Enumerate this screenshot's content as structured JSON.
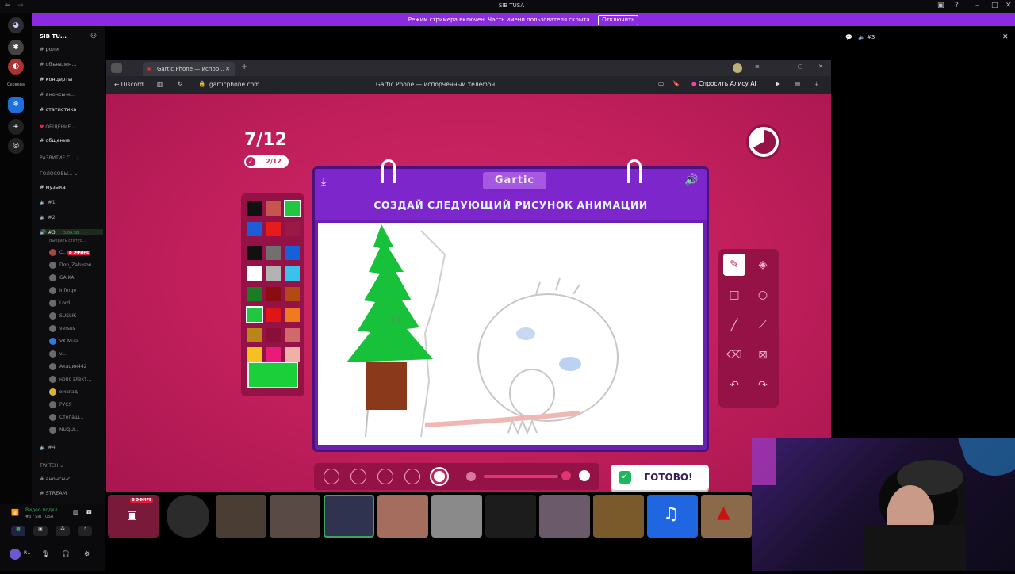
{
  "window_title": "SIB TUSA",
  "stream_mode": {
    "message": "Режим стримера включен. Часть имени пользователя скрыта.",
    "button": "Отключить"
  },
  "servers": {
    "label_under_first": "Сервера"
  },
  "sidebar": {
    "server_name": "SIB TU...",
    "items": [
      {
        "type": "text",
        "label": "роли"
      },
      {
        "type": "text",
        "label": "объявлен..."
      },
      {
        "type": "text",
        "label": "концерты"
      },
      {
        "type": "text",
        "label": "анонсы-к..."
      },
      {
        "type": "text",
        "label": "статистика"
      },
      {
        "type": "category",
        "label": "ОБЩЕНИЕ"
      },
      {
        "type": "text",
        "label": "общение"
      },
      {
        "type": "category",
        "label": "РАЗВИТИЕ С..."
      },
      {
        "type": "category",
        "label": "ГОЛОСОВЫ..."
      },
      {
        "type": "text",
        "label": "музыка"
      },
      {
        "type": "voice",
        "label": "#1"
      },
      {
        "type": "voice",
        "label": "#2"
      },
      {
        "type": "voice",
        "label": "#3"
      }
    ],
    "current_voice_status": "Выбрать статус...",
    "current_voice_time": "3:06:38",
    "voice_users": [
      {
        "name": "С..",
        "live": "В ЭФИРЕ"
      },
      {
        "name": "Don_Zakuson"
      },
      {
        "name": "GAIKA"
      },
      {
        "name": "Inferge"
      },
      {
        "name": "Lord"
      },
      {
        "name": "SUSLIK"
      },
      {
        "name": "versus"
      },
      {
        "name": "VK Musi..."
      },
      {
        "name": "v..."
      },
      {
        "name": "Акация442"
      },
      {
        "name": "нопс элект..."
      },
      {
        "name": "омагад"
      },
      {
        "name": "РУСЯ"
      },
      {
        "name": "Степаш..."
      },
      {
        "name": "NUQUI..."
      }
    ],
    "after_items": [
      {
        "type": "voice",
        "label": "#4"
      },
      {
        "type": "category",
        "label": "TWITCH"
      },
      {
        "type": "text",
        "label": "анонсы-с..."
      },
      {
        "type": "text",
        "label": "STREAM"
      }
    ]
  },
  "voice_panel": {
    "title": "Видео подкл...",
    "channel": "#3 / SIB TUSA",
    "user": "P..."
  },
  "right_pane": {
    "channel": "#3"
  },
  "browser": {
    "tab_title": "Gartic Phone — испор...",
    "back_label": "Discord",
    "address": "garticphone.com",
    "page_title": "Gartic Phone — испорченный телефон",
    "alice": "Спросить Алису AI"
  },
  "game": {
    "round": "7/12",
    "done_count": "2/12",
    "logo": "Gartic",
    "instruction": "СОЗДАЙ СЛЕДУЮЩИЙ РИСУНОК АНИМАЦИИ",
    "done_button": "ГОТОВО!",
    "palette": [
      "#111111",
      "#c8544f",
      "#21c83f",
      "#1d5ed8",
      "#e61b1b",
      "#9a1a46",
      "#111111",
      "#707070",
      "#1561d9",
      "#ffffff",
      "#b3b3b3",
      "#3ac2ec",
      "#1a7c24",
      "#8a0d12",
      "#b34a14",
      "#21c83f",
      "#e01515",
      "#f07a1f",
      "#b9851a",
      "#8a0f36",
      "#d06a6a",
      "#f5c022",
      "#e81a7a",
      "#f0b0a8"
    ],
    "selected_color": "#1bcf3a",
    "brush_sizes": [
      1,
      2,
      3,
      4,
      5
    ],
    "selected_brush": 5,
    "opacity": 0.85
  },
  "strip": {
    "live_badge": "В ЭФИРЕ"
  }
}
